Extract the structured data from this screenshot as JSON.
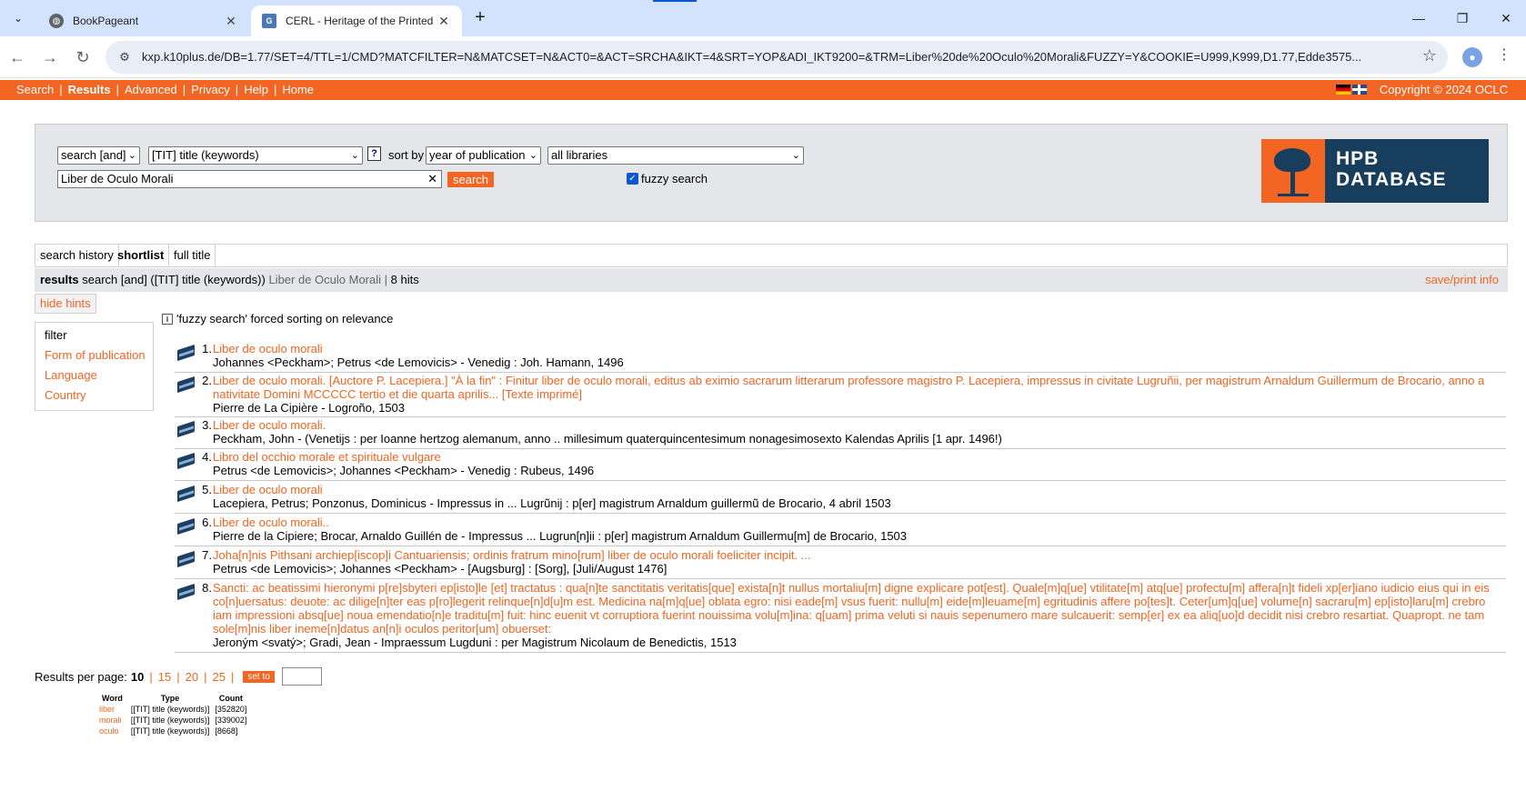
{
  "browser": {
    "tabs": [
      {
        "title": "BookPageant",
        "active": false
      },
      {
        "title": "CERL - Heritage of the Printed B",
        "active": true
      }
    ],
    "new_tab_label": "+",
    "url": "kxp.k10plus.de/DB=1.77/SET=4/TTL=1/CMD?MATCFILTER=N&MATCSET=N&ACT0=&ACT=SRCHA&IKT=4&SRT=YOP&ADI_IKT9200=&TRM=Liber%20de%20Oculo%20Morali&FUZZY=Y&COOKIE=U999,K999,D1.77,Edde3575...",
    "active_tab_favicon_letter": "G"
  },
  "nav": {
    "links": [
      "Search",
      "Results",
      "Advanced",
      "Privacy",
      "Help",
      "Home"
    ],
    "current": "Results",
    "copyright": "Copyright © 2024 OCLC"
  },
  "search": {
    "operator": "search [and]",
    "field": "[TIT] title (keywords)",
    "help": "?",
    "sort_label": "sort by",
    "sort": "year of publication",
    "library": "all libraries",
    "query": "Liber de Oculo Morali",
    "button": "search",
    "fuzzy_label": "fuzzy search",
    "fuzzy_checked": true,
    "logo_line1": "HPB",
    "logo_line2": "DATABASE"
  },
  "view_tabs": [
    "search history",
    "shortlist",
    "full title"
  ],
  "results_bar": {
    "label": "results",
    "query_desc": "search [and] ([TIT] title (keywords))",
    "query": "Liber de Oculo Morali",
    "hits": "8 hits",
    "save": "save/print info"
  },
  "hide_hints": "hide hints",
  "hint": "'fuzzy search' forced sorting on relevance",
  "filter": {
    "heading": "filter",
    "items": [
      "Form of publication",
      "Language",
      "Country"
    ]
  },
  "hits": [
    {
      "num": "1.",
      "title": "Liber de oculo morali",
      "meta": "Johannes <Peckham>; Petrus <de Lemovicis> - Venedig : Joh. Hamann, 1496"
    },
    {
      "num": "2.",
      "title": "Liber de oculo morali. [Auctore P. Lacepiera.] \"À la fin\" : Finitur liber de oculo morali, editus ab eximio sacrarum litterarum professore magistro P. Lacepiera, impressus in civitate Lugruñii, per magistrum Arnaldum Guillermum de Brocario, anno a nativitate Domini MCCCCC tertio et die quarta aprilis... [Texte imprimé]",
      "meta": "Pierre de La Cipière - Logroño, 1503"
    },
    {
      "num": "3.",
      "title": "Liber de oculo morali.",
      "meta": "Peckham, John - (Venetijs : per Ioanne hertzog alemanum, anno .. millesimum quaterquincentesimum nonagesimosexto Kalendas Aprilis [1 apr. 1496!)"
    },
    {
      "num": "4.",
      "title": "Libro del occhio morale et spirituale vulgare",
      "meta": "Petrus <de Lemovicis>; Johannes <Peckham> - Venedig : Rubeus, 1496"
    },
    {
      "num": "5.",
      "title": "Liber de oculo morali",
      "meta": "Lacepiera, Petrus; Ponzonus, Dominicus - Impressus in ... Lugrũnij : p[er] magistrum Arnaldum guillermũ de Brocario, 4 abril 1503"
    },
    {
      "num": "6.",
      "title": "Liber de oculo morali..",
      "meta": "Pierre de la Cipiere; Brocar, Arnaldo Guillén de - Impressus ... Lugrun[n]ii : p[er] magistrum Arnaldum Guillermu[m] de Brocario, 1503"
    },
    {
      "num": "7.",
      "title": "Joha[n]nis Pithsani archiep[iscop]i Cantuariensis; ordinis fratrum mino[rum] liber de oculo morali foeliciter incipit. ...",
      "meta": "Petrus <de Lemovicis>; Johannes <Peckham> - [Augsburg] : [Sorg], [Juli/August 1476]"
    },
    {
      "num": "8.",
      "title": "Sancti: ac beatissimi hieronymi p[re]sbyteri ep[isto]le [et] tractatus : qua[n]te sanctitatis veritatis[que] exista[n]t nullus mortaliu[m] digne explicare pot[est]. Quale[m]q[ue] vtilitate[m] atq[ue] profectu[m] affera[n]t fideli xp[er]iano iudicio eius qui in eis co[n]uersatus: deuote: ac dilige[n]ter eas p[ro]legerit relinque[n]d[u]m est. Medicina na[m]q[ue] oblata egro: nisi eade[m] vsus fuerit: nullu[m] eide[m]leuame[m] egritudinis affere po[tes]t. Ceter[um]q[ue] volume[n] sacraru[m] ep[isto]laru[m] crebro iam impressioni absq[ue] noua emendatio[n]e traditu[m] fuit: hinc euenit vt corruptiora fuerint nouissima volu[m]ina: q[uam] prima veluti si nauis sepenumero mare sulcauerit: semp[er] ex ea aliq[uo]d decidit nisi crebro resartiat. Quapropt. ne tam sole[m]nis liber ineme[n]datus an[n]i oculos peritor[um] obuerset:",
      "meta": "Jeroným <svatý>; Gradi, Jean - Impraessum Lugduni : per Magistrum Nicolaum de Benedictis, 1513"
    }
  ],
  "per_page": {
    "label": "Results per page:",
    "current": "10",
    "options": [
      "15",
      "20",
      "25"
    ],
    "set_button": "set to"
  },
  "words_table": {
    "headers": [
      "Word",
      "Type",
      "Count"
    ],
    "rows": [
      {
        "word": "liber",
        "type": "[[TIT] title (keywords)]",
        "count": "[352820]"
      },
      {
        "word": "morali",
        "type": "[[TIT] title (keywords)]",
        "count": "[339002]"
      },
      {
        "word": "oculo",
        "type": "[[TIT] title (keywords)]",
        "count": "[8668]"
      }
    ]
  }
}
